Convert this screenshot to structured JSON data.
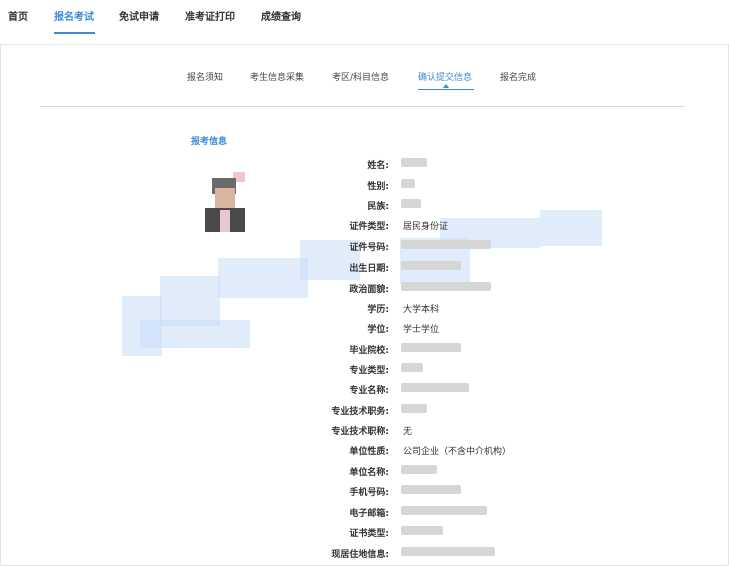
{
  "topnav": {
    "items": [
      {
        "label": "首页",
        "active": false
      },
      {
        "label": "报名考试",
        "active": true
      },
      {
        "label": "免试申请",
        "active": false
      },
      {
        "label": "准考证打印",
        "active": false
      },
      {
        "label": "成绩查询",
        "active": false
      }
    ]
  },
  "steps": [
    {
      "label": "报名须知"
    },
    {
      "label": "考生信息采集"
    },
    {
      "label": "考区/科目信息"
    },
    {
      "label": "确认提交信息",
      "active": true
    },
    {
      "label": "报名完成"
    }
  ],
  "section": {
    "title": "报考信息"
  },
  "fields": [
    {
      "label": "姓名:",
      "value": ""
    },
    {
      "label": "性别:",
      "value": ""
    },
    {
      "label": "民族:",
      "value": ""
    },
    {
      "label": "证件类型:",
      "value": "居民身份证"
    },
    {
      "label": "证件号码:",
      "value": ""
    },
    {
      "label": "出生日期:",
      "value": ""
    },
    {
      "label": "政治面貌:",
      "value": ""
    },
    {
      "label": "学历:",
      "value": "大学本科"
    },
    {
      "label": "学位:",
      "value": "学士学位"
    },
    {
      "label": "毕业院校:",
      "value": ""
    },
    {
      "label": "专业类型:",
      "value": ""
    },
    {
      "label": "专业名称:",
      "value": ""
    },
    {
      "label": "专业技术职务:",
      "value": ""
    },
    {
      "label": "专业技术职称:",
      "value": "无"
    },
    {
      "label": "单位性质:",
      "value": "公司企业（不含中介机构）"
    },
    {
      "label": "单位名称:",
      "value": ""
    },
    {
      "label": "手机号码:",
      "value": ""
    },
    {
      "label": "电子邮箱:",
      "value": ""
    },
    {
      "label": "证书类型:",
      "value": ""
    },
    {
      "label": "现居住地信息:",
      "value": ""
    }
  ],
  "colors": {
    "accent": "#3d8bd6",
    "divider": "#d8d8d8"
  }
}
